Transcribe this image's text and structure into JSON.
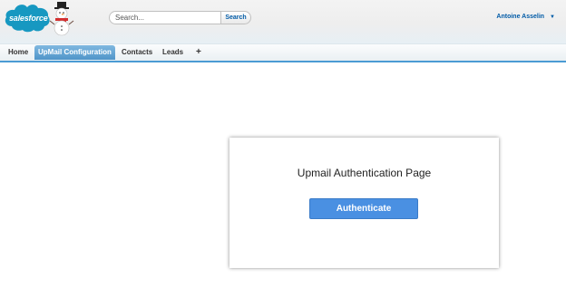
{
  "brand": {
    "logo_text": "salesforce"
  },
  "search": {
    "placeholder": "Search...",
    "button_label": "Search"
  },
  "user": {
    "name": "Antoine Asselin"
  },
  "tabs": [
    {
      "label": "Home"
    },
    {
      "label": "UpMail Configuration",
      "active": true
    },
    {
      "label": "Contacts"
    },
    {
      "label": "Leads"
    },
    {
      "label": "+"
    }
  ],
  "card": {
    "title": "Upmail Authentication Page",
    "button_label": "Authenticate"
  },
  "colors": {
    "accent": "#4a90e2",
    "brand_blue": "#1798c1",
    "link": "#015ba7",
    "tab_active": "#5a9fd4"
  }
}
